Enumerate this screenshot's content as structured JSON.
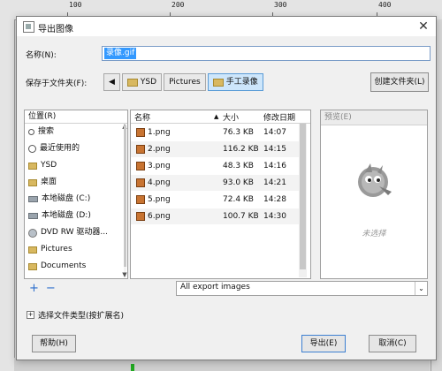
{
  "ruler": {
    "marks": [
      "100",
      "200",
      "300",
      "400"
    ]
  },
  "dialog": {
    "title": "导出图像",
    "name_label": "名称(N):",
    "name_value": "录像.gif",
    "save_in_label": "保存于文件夹(F):",
    "path": [
      "YSD",
      "Pictures",
      "手工录像"
    ],
    "create_folder": "创建文件夹(L)"
  },
  "places": {
    "header": "位置(R)",
    "items": [
      {
        "icon": "search-icon",
        "label": "搜索"
      },
      {
        "icon": "recent-icon",
        "label": "最近使用的"
      },
      {
        "icon": "folder-icon",
        "label": "YSD"
      },
      {
        "icon": "folder-icon",
        "label": "桌面"
      },
      {
        "icon": "drive-icon",
        "label": "本地磁盘 (C:)"
      },
      {
        "icon": "drive-icon",
        "label": "本地磁盘 (D:)"
      },
      {
        "icon": "dvd-icon",
        "label": "DVD RW 驱动器..."
      },
      {
        "icon": "folder-icon",
        "label": "Pictures"
      },
      {
        "icon": "folder-icon",
        "label": "Documents"
      }
    ]
  },
  "files": {
    "columns": {
      "name": "名称",
      "size": "大小",
      "modified": "修改日期"
    },
    "rows": [
      {
        "name": "1.png",
        "size": "76.3 KB",
        "time": "14:07"
      },
      {
        "name": "2.png",
        "size": "116.2 KB",
        "time": "14:15"
      },
      {
        "name": "3.png",
        "size": "48.3 KB",
        "time": "14:16"
      },
      {
        "name": "4.png",
        "size": "93.0 KB",
        "time": "14:21"
      },
      {
        "name": "5.png",
        "size": "72.4 KB",
        "time": "14:28"
      },
      {
        "name": "6.png",
        "size": "100.7 KB",
        "time": "14:30"
      }
    ]
  },
  "preview": {
    "header": "预览(E)",
    "empty": "未选择"
  },
  "filter": {
    "value": "All export images"
  },
  "file_type": "选择文件类型(按扩展名)",
  "buttons": {
    "help": "帮助(H)",
    "export": "导出(E)",
    "cancel": "取消(C)"
  }
}
